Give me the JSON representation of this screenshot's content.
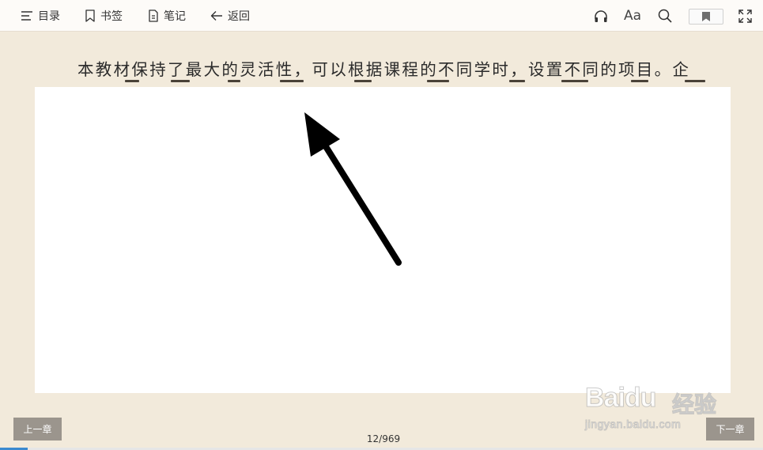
{
  "toolbar": {
    "toc_label": "目录",
    "bookmark_label": "书签",
    "notes_label": "笔记",
    "back_label": "返回",
    "font_label": "Aa"
  },
  "content": {
    "paragraph_visible": "本教材保持了最大的灵活性，可以根据课程的不同学时，设置不同的项目。企"
  },
  "footer": {
    "prev_label": "上一章",
    "next_label": "下一章",
    "page_indicator": "12/969"
  },
  "progress": {
    "fraction": 0.036
  },
  "watermark": {
    "brand": "Baidu",
    "brand_cn": "经验",
    "url": "jingyan.baidu.com"
  },
  "colors": {
    "page_background": "#f2eadb",
    "toolbar_background": "#fdfbf8",
    "progress_fill": "#3b8ad0",
    "nav_button": "#9b958d",
    "annotation_arrow": "#000000"
  }
}
